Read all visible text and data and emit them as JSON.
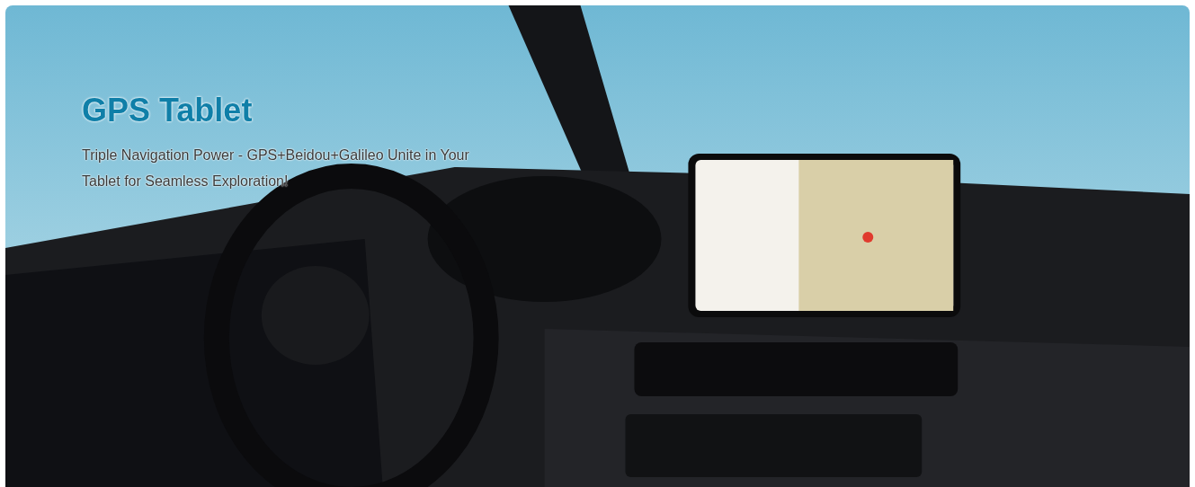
{
  "banner": {
    "title": "GPS Tablet",
    "subtitle": "Triple Navigation Power - GPS+Beidou+Galileo Unite in Your Tablet for Seamless Exploration!"
  }
}
